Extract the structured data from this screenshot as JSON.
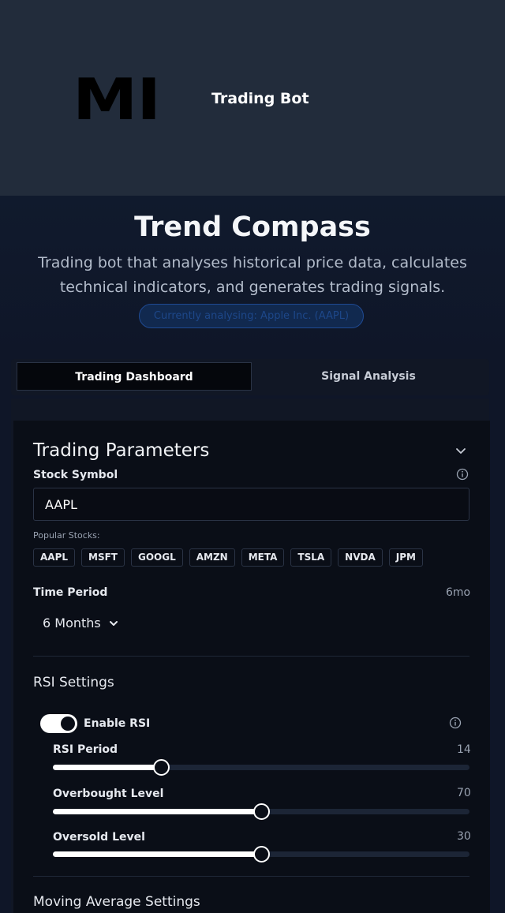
{
  "header": {
    "logo_text": "MI",
    "app_name": "Trading Bot"
  },
  "hero": {
    "title": "Trend Compass",
    "description": "Trading bot that analyses historical price data, calculates technical indicators, and generates trading signals.",
    "status_badge": "Currently analysing: Apple Inc. (AAPL)"
  },
  "tabs": [
    {
      "label": "Trading Dashboard",
      "active": true
    },
    {
      "label": "Signal Analysis",
      "active": false
    }
  ],
  "params": {
    "title": "Trading Parameters",
    "stock_symbol_label": "Stock Symbol",
    "stock_symbol_value": "AAPL",
    "popular_label": "Popular Stocks:",
    "popular": [
      "AAPL",
      "MSFT",
      "GOOGL",
      "AMZN",
      "META",
      "TSLA",
      "NVDA",
      "JPM"
    ],
    "time_period_label": "Time Period",
    "time_period_code": "6mo",
    "time_period_value": "6 Months"
  },
  "rsi": {
    "section_title": "RSI Settings",
    "enable_label": "Enable RSI",
    "enabled": true,
    "period_label": "RSI Period",
    "period_value": "14",
    "period_fraction": 0.26,
    "overbought_label": "Overbought Level",
    "overbought_value": "70",
    "overbought_fraction": 0.5,
    "oversold_label": "Oversold Level",
    "oversold_value": "30",
    "oversold_fraction": 0.5
  },
  "ma": {
    "section_title": "Moving Average Settings"
  },
  "colors": {
    "background": "#0f1628",
    "header": "#222c3b",
    "accent": "#ffffff",
    "badge": "#1f4a93"
  }
}
